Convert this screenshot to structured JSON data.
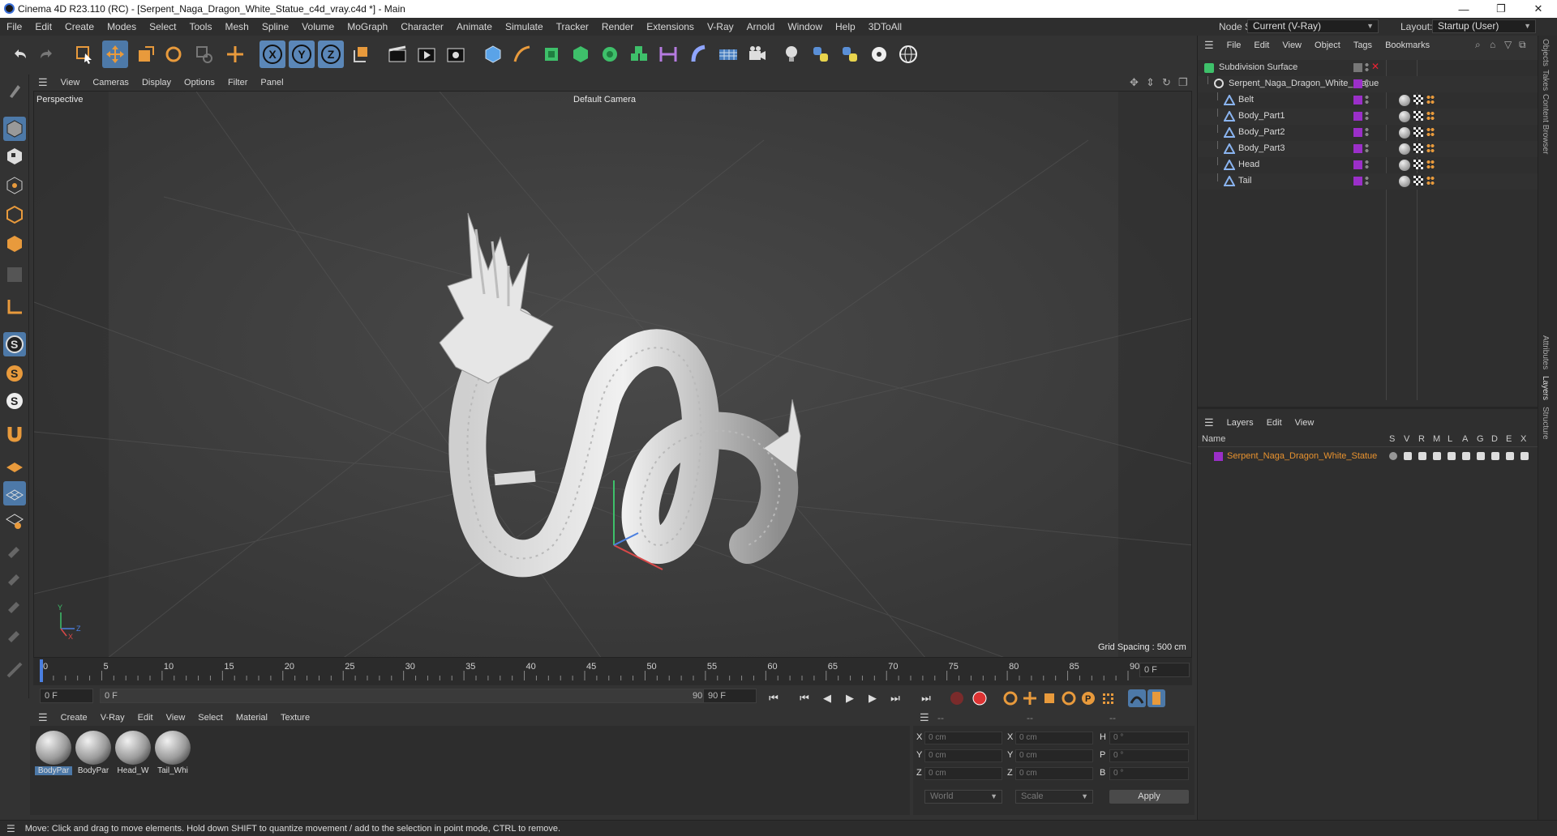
{
  "window": {
    "title": "Cinema 4D R23.110 (RC) - [Serpent_Naga_Dragon_White_Statue_c4d_vray.c4d *] - Main",
    "minimize": "—",
    "maximize": "❐",
    "close": "✕"
  },
  "menubar": {
    "items": [
      "File",
      "Edit",
      "Create",
      "Modes",
      "Select",
      "Tools",
      "Mesh",
      "Spline",
      "Volume",
      "MoGraph",
      "Character",
      "Animate",
      "Simulate",
      "Tracker",
      "Render",
      "Extensions",
      "V-Ray",
      "Arnold",
      "Window",
      "Help",
      "3DToAll"
    ],
    "node_space_label": "Node Space:",
    "node_space_value": "Current (V-Ray)",
    "layout_label": "Layout:",
    "layout_value": "Startup (User)"
  },
  "toolbar": {
    "axis_x": "X",
    "axis_y": "Y",
    "axis_z": "Z"
  },
  "viewport": {
    "menu": [
      "View",
      "Cameras",
      "Display",
      "Options",
      "Filter",
      "Panel"
    ],
    "label": "Perspective",
    "camera": "Default Camera",
    "grid_spacing": "Grid Spacing : 500 cm",
    "axis_y": "Y",
    "axis_z": "Z",
    "axis_x": "X"
  },
  "timeline": {
    "ticks": [
      "0",
      "5",
      "10",
      "15",
      "20",
      "25",
      "30",
      "35",
      "40",
      "45",
      "50",
      "55",
      "60",
      "65",
      "70",
      "75",
      "80",
      "85",
      "90"
    ],
    "current_frame": "0 F",
    "start_field": "0 F",
    "range_start": "0 F",
    "range_end": "90 F",
    "end_field": "90 F"
  },
  "material_manager": {
    "menu": [
      "Create",
      "V-Ray",
      "Edit",
      "View",
      "Select",
      "Material",
      "Texture"
    ],
    "materials": [
      "BodyPar",
      "BodyPar",
      "Head_W",
      "Tail_Whi"
    ]
  },
  "coordinates": {
    "header": [
      "--",
      "--",
      "--"
    ],
    "pos_labels": [
      "X",
      "Y",
      "Z"
    ],
    "size_labels": [
      "X",
      "Y",
      "Z"
    ],
    "rot_labels": [
      "H",
      "P",
      "B"
    ],
    "pos_values": [
      "0 cm",
      "0 cm",
      "0 cm"
    ],
    "size_values": [
      "0 cm",
      "0 cm",
      "0 cm"
    ],
    "rot_values": [
      "0 °",
      "0 °",
      "0 °"
    ],
    "space": "World",
    "mode": "Scale",
    "apply": "Apply"
  },
  "status": {
    "text": "Move: Click and drag to move elements. Hold down SHIFT to quantize movement / add to the selection in point mode, CTRL to remove."
  },
  "object_manager": {
    "menu": [
      "File",
      "Edit",
      "View",
      "Object",
      "Tags",
      "Bookmarks"
    ],
    "objects": [
      {
        "name": "Subdivision Surface",
        "depth": 0
      },
      {
        "name": "Serpent_Naga_Dragon_White_Statue",
        "depth": 1
      },
      {
        "name": "Belt",
        "depth": 2
      },
      {
        "name": "Body_Part1",
        "depth": 2
      },
      {
        "name": "Body_Part2",
        "depth": 2
      },
      {
        "name": "Body_Part3",
        "depth": 2
      },
      {
        "name": "Head",
        "depth": 2
      },
      {
        "name": "Tail",
        "depth": 2
      }
    ],
    "layer_color": "#9b2fc9"
  },
  "layer_manager": {
    "menu": [
      "Layers",
      "Edit",
      "View"
    ],
    "name_col": "Name",
    "columns": [
      "S",
      "V",
      "R",
      "M",
      "L",
      "A",
      "G",
      "D",
      "E",
      "X"
    ],
    "layers": [
      "Serpent_Naga_Dragon_White_Statue"
    ],
    "layer_text_color": "#e8922f"
  },
  "side_tabs": [
    "Objects",
    "Takes",
    "Content Browser",
    "Attributes",
    "Layers",
    "Structure"
  ]
}
